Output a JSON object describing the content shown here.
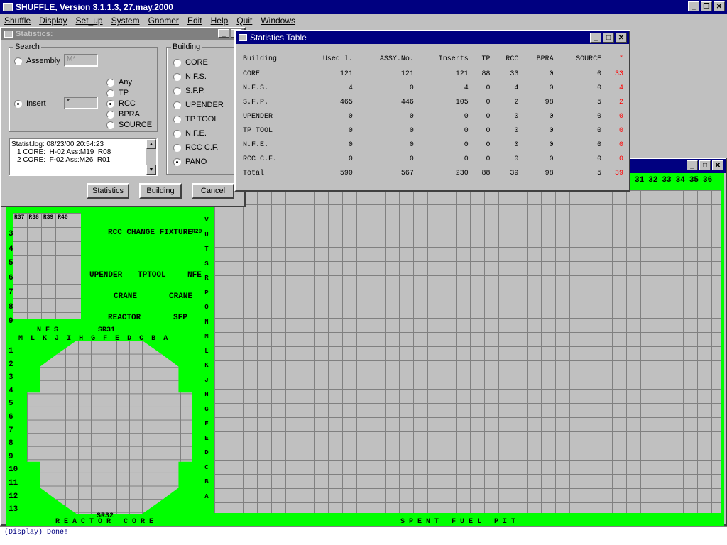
{
  "app": {
    "title": "SHUFFLE, Version 3.1.1.3, 27.may.2000",
    "menu": [
      "Shuffle",
      "Display",
      "Set_up",
      "System",
      "Gnomer",
      "Edit",
      "Help",
      "Quit",
      "Windows"
    ]
  },
  "stats_dialog": {
    "title": "Statistics:",
    "search_label": "Search",
    "assembly_label": "Assembly",
    "assembly_value": "M*",
    "insert_label": "Insert",
    "insert_value": "*",
    "insert_types": [
      "Any",
      "TP",
      "RCC",
      "BPRA",
      "SOURCE"
    ],
    "insert_selected": "RCC",
    "building_label": "Building",
    "buildings": [
      "CORE",
      "N.F.S.",
      "S.F.P.",
      "UPENDER",
      "TP TOOL",
      "N.F.E.",
      "RCC C.F.",
      "PANO"
    ],
    "building_selected": "PANO",
    "log": [
      "Statist.log: 08/23/00 20:54:23",
      "1 CORE:  H-02 Ass:M19  R08",
      "2 CORE:  F-02 Ass:M26  R01"
    ],
    "buttons": [
      "Statistics",
      "Building",
      "Cancel"
    ]
  },
  "table_dialog": {
    "title": "Statistics Table",
    "headers": [
      "Building",
      "Used l.",
      "ASSY.No.",
      "Inserts",
      "TP",
      "RCC",
      "BPRA",
      "SOURCE",
      "*"
    ],
    "rows": [
      [
        "CORE",
        "121",
        "121",
        "121",
        "88",
        "33",
        "0",
        "0",
        "33"
      ],
      [
        "N.F.S.",
        "4",
        "0",
        "4",
        "0",
        "4",
        "0",
        "0",
        "4"
      ],
      [
        "S.F.P.",
        "465",
        "446",
        "105",
        "0",
        "2",
        "98",
        "5",
        "2"
      ],
      [
        "UPENDER",
        "0",
        "0",
        "0",
        "0",
        "0",
        "0",
        "0",
        "0"
      ],
      [
        "TP TOOL",
        "0",
        "0",
        "0",
        "0",
        "0",
        "0",
        "0",
        "0"
      ],
      [
        "N.F.E.",
        "0",
        "0",
        "0",
        "0",
        "0",
        "0",
        "0",
        "0"
      ],
      [
        "RCC C.F.",
        "0",
        "0",
        "0",
        "0",
        "0",
        "0",
        "0",
        "0"
      ],
      [
        "Total",
        "590",
        "567",
        "230",
        "88",
        "39",
        "98",
        "5",
        "39"
      ]
    ]
  },
  "map": {
    "rcc_change": "RCC CHANGE FIXTURE",
    "upender": "UPENDER",
    "tptool": "TPTOOL",
    "nfe": "NFE",
    "crane": "CRANE",
    "reactor": "REACTOR",
    "sfp": "SFP",
    "nfs": "N F S",
    "sr31": "SR31",
    "sr32": "SR32",
    "reactor_core": "R E A C T O R   C O R E",
    "spent_fuel_pit": "S P E N T   F U E L   P I T",
    "core_cols": [
      "M",
      "L",
      "K",
      "J",
      "I",
      "H",
      "G",
      "F",
      "E",
      "D",
      "C",
      "B",
      "A"
    ],
    "rows": [
      "3",
      "4",
      "5",
      "6",
      "7",
      "8",
      "9"
    ],
    "core_rows": [
      "1",
      "2",
      "3",
      "4",
      "5",
      "6",
      "7",
      "8",
      "9",
      "10",
      "11",
      "12",
      "13"
    ],
    "pit_cols": [
      "31",
      "32",
      "33",
      "34",
      "35",
      "36"
    ],
    "rack_labels": [
      "R37",
      "R38",
      "R39",
      "R40"
    ],
    "r20": "R20",
    "vert_letters": [
      "V",
      "U",
      "T",
      "S",
      "R",
      "P",
      "O",
      "N",
      "M",
      "L",
      "K",
      "J",
      "H",
      "G",
      "F",
      "E",
      "D",
      "C",
      "B",
      "A"
    ]
  },
  "status": "(Display) Done!"
}
